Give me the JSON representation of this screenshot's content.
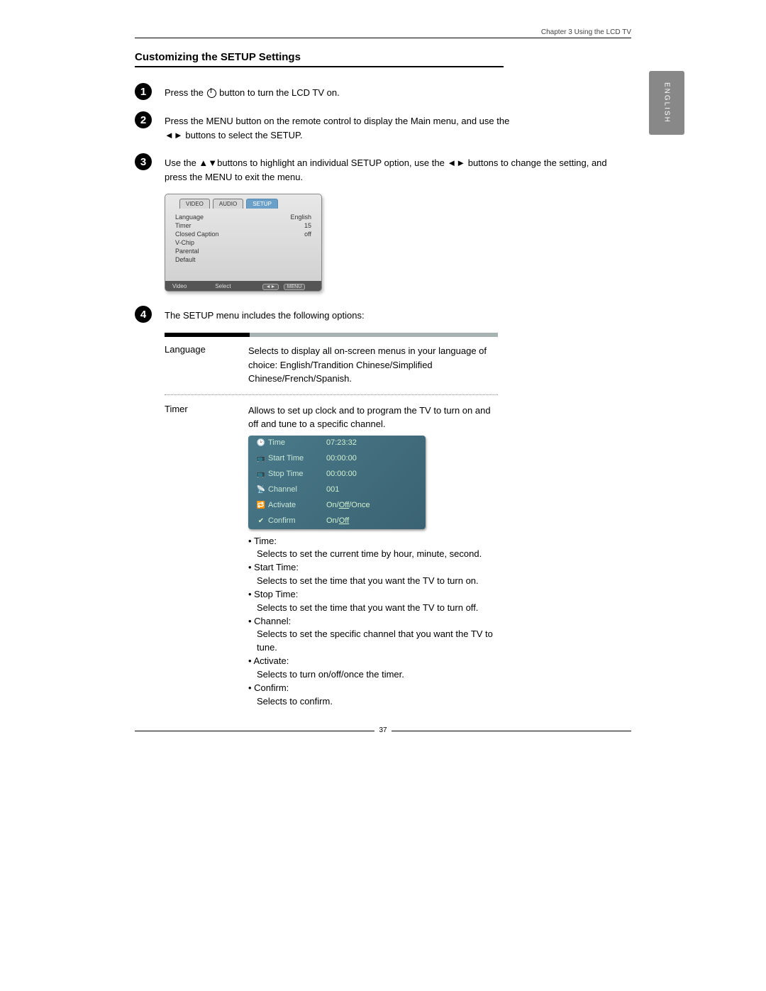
{
  "header": "Chapter 3 Using the LCD TV",
  "side_tab": "ENGLISH",
  "title": "Customizing the SETUP Settings",
  "steps": {
    "s1a": "Press the ",
    "s1b": " button to turn the LCD TV on.",
    "s2a": "Press the MENU button on the remote control to display the Main menu, and use the ",
    "s2arrows": "◄►",
    "s2b": " buttons to select the SETUP.",
    "s3a": "Use the ",
    "s3ud": "▲▼",
    "s3b": "buttons to highlight an individual SETUP option, use the ",
    "s3lr": "◄►",
    "s3c": " buttons to change the setting, and press the MENU to exit the menu.",
    "s4": "The SETUP menu includes the following options:"
  },
  "osd": {
    "tabs": {
      "video": "VIDEO",
      "audio": "AUDIO",
      "setup": "SETUP"
    },
    "rows": [
      {
        "k": "Language",
        "v": "English"
      },
      {
        "k": "Timer",
        "v": "15"
      },
      {
        "k": "Closed Caption",
        "v": "off"
      },
      {
        "k": "V-Chip",
        "v": ""
      },
      {
        "k": "Parental",
        "v": ""
      },
      {
        "k": "Default",
        "v": ""
      }
    ],
    "foot": {
      "left": "Video",
      "mid": "Select",
      "btn1": "◄►",
      "btn2": "MENU"
    }
  },
  "options": {
    "language": {
      "label": "Language",
      "desc": "Selects to display all on-screen menus in your language of choice: English/Trandition Chinese/Simplified Chinese/French/Spanish."
    },
    "timer": {
      "label": "Timer",
      "desc": "Allows to set up clock and to program the TV to turn on and off and tune to a specific channel."
    }
  },
  "timer_osd": [
    {
      "icon": "🕑",
      "k": "Time",
      "v": "07:23:32"
    },
    {
      "icon": "📺",
      "k": "Start Time",
      "v": "00:00:00"
    },
    {
      "icon": "📺",
      "k": "Stop Time",
      "v": "00:00:00"
    },
    {
      "icon": "📡",
      "k": "Channel",
      "v": "001"
    },
    {
      "icon": "🔁",
      "k": "Activate",
      "v": "On/Off/Once",
      "und": "Off"
    },
    {
      "icon": "✔",
      "k": "Confirm",
      "v": "On/Off",
      "und": "Off"
    }
  ],
  "bullets": {
    "time_h": "Time:",
    "time_d": "Selects to set the current time by hour, minute, second.",
    "start_h": "Start Time:",
    "start_d": "Selects to set the time that you want the TV to turn on.",
    "stop_h": "Stop Time:",
    "stop_d": "Selects to set the time that you want the TV to turn off.",
    "chan_h": "Channel:",
    "chan_d": "Selects to set the specific channel that you want the TV to tune.",
    "act_h": "Activate:",
    "act_d": "Selects to turn on/off/once the timer.",
    "conf_h": "Confirm:",
    "conf_d": "Selects to confirm."
  },
  "page_number": "37"
}
